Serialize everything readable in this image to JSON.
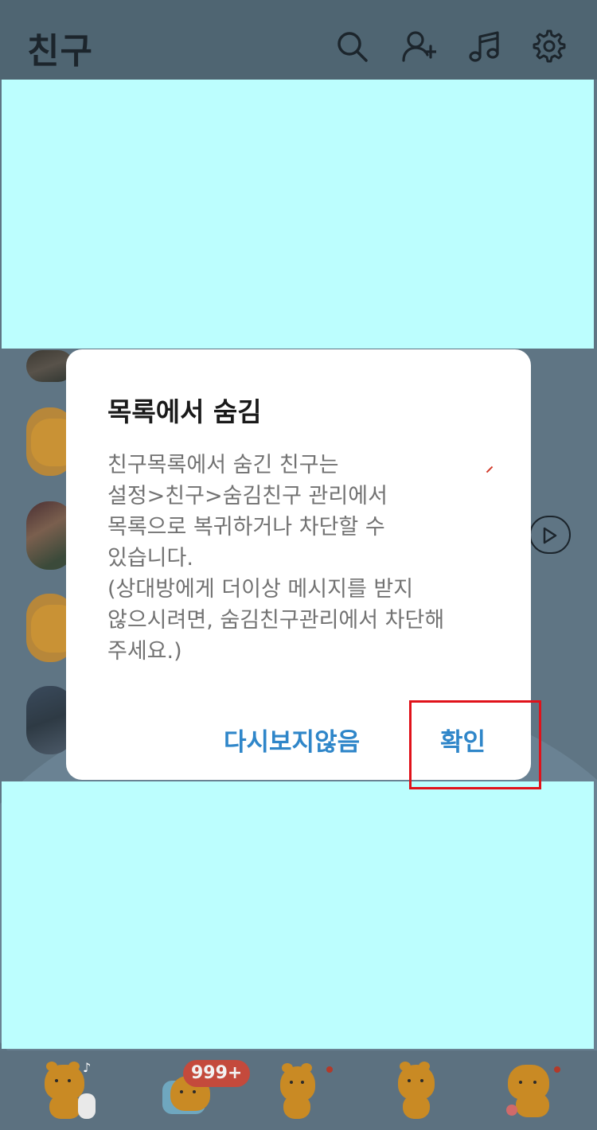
{
  "header": {
    "title": "친구",
    "icons": [
      "search-icon",
      "add-friend-icon",
      "music-icon",
      "settings-icon"
    ]
  },
  "dialog": {
    "title": "목록에서 숨김",
    "body_lines": [
      "친구목록에서 숨긴 친구는",
      "설정>친구>숨김친구 관리에서",
      "목록으로 복귀하거나 차단할 수",
      "있습니다.",
      "(상대방에게 더이상 메시지를 받지",
      "않으시려면, 숨김친구관리에서 차단해",
      "주세요.)"
    ],
    "dismiss_label": "다시보지않음",
    "confirm_label": "확인"
  },
  "bottom_bar": {
    "tabs": [
      "friends-tab",
      "chats-tab",
      "view-tab",
      "shopping-tab",
      "more-tab"
    ],
    "chat_badge": "999+"
  },
  "colors": {
    "accent": "#2f86c9",
    "highlight": "#e0121a",
    "placeholder_block": "#bcfefe"
  }
}
